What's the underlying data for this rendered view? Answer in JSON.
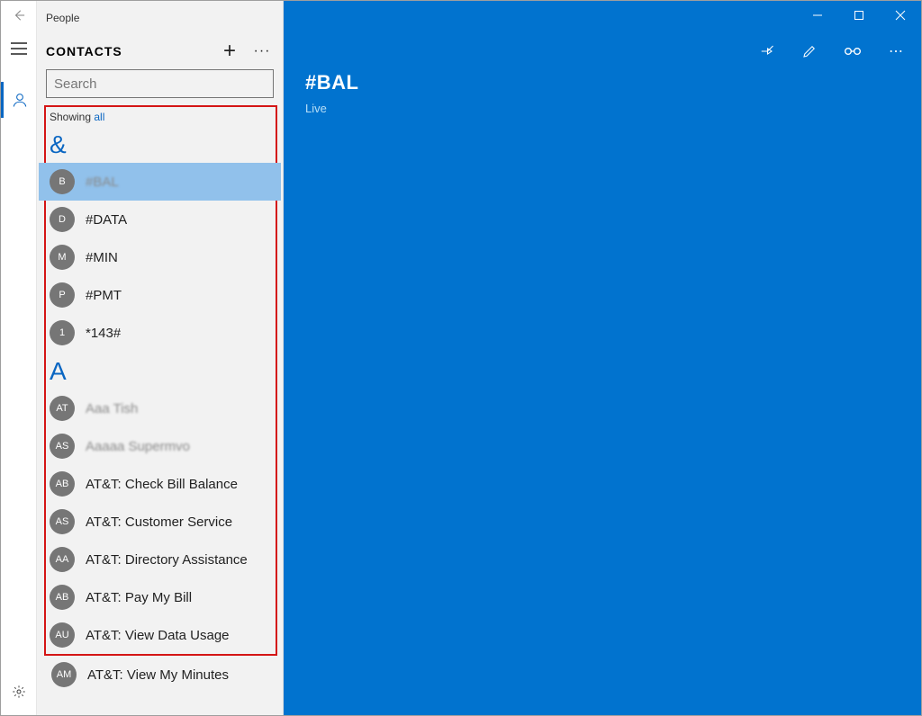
{
  "app_title": "People",
  "panel": {
    "heading": "CONTACTS",
    "search_placeholder": "Search",
    "showing_prefix": "Showing ",
    "showing_link": "all"
  },
  "groups": [
    {
      "letter": "&",
      "contacts": [
        {
          "initials": "B",
          "name": "#BAL",
          "selected": true,
          "blurred": true
        },
        {
          "initials": "D",
          "name": "#DATA",
          "selected": false,
          "blurred": false
        },
        {
          "initials": "M",
          "name": "#MIN",
          "selected": false,
          "blurred": false
        },
        {
          "initials": "P",
          "name": "#PMT",
          "selected": false,
          "blurred": false
        },
        {
          "initials": "1",
          "name": "*143#",
          "selected": false,
          "blurred": false
        }
      ]
    },
    {
      "letter": "A",
      "contacts": [
        {
          "initials": "AT",
          "name": "Aaa Tish",
          "selected": false,
          "blurred": true
        },
        {
          "initials": "AS",
          "name": "Aaaaa Supermvo",
          "selected": false,
          "blurred": true
        },
        {
          "initials": "AB",
          "name": "AT&T: Check Bill Balance",
          "selected": false,
          "blurred": false
        },
        {
          "initials": "AS",
          "name": "AT&T: Customer Service",
          "selected": false,
          "blurred": false
        },
        {
          "initials": "AA",
          "name": "AT&T: Directory Assistance",
          "selected": false,
          "blurred": false
        },
        {
          "initials": "AB",
          "name": "AT&T: Pay My Bill",
          "selected": false,
          "blurred": false
        },
        {
          "initials": "AU",
          "name": "AT&T: View Data Usage",
          "selected": false,
          "blurred": false
        }
      ]
    }
  ],
  "overflow_contact": {
    "initials": "AM",
    "name": "AT&T: View My Minutes"
  },
  "detail": {
    "title": "#BAL",
    "subtitle": "Live"
  },
  "icons": {
    "add": "+",
    "more": "···",
    "more_v": "⋯"
  }
}
